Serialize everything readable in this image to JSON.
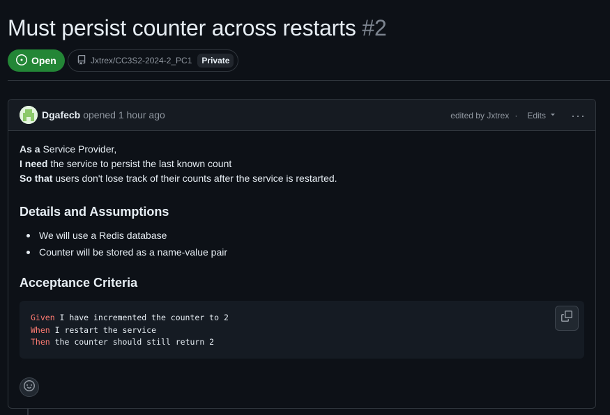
{
  "issue": {
    "title": "Must persist counter across restarts",
    "number": "#2",
    "state": "Open",
    "repo": "Jxtrex/CC3S2-2024-2_PC1",
    "visibility": "Private"
  },
  "comment": {
    "author": "Dgafecb",
    "opened_text": "opened 1 hour ago",
    "edited_text": "edited by Jxtrex",
    "separator": "·",
    "edits_label": "Edits",
    "more_label": "···",
    "story": [
      {
        "bold": "As a",
        "text": " Service Provider,"
      },
      {
        "bold": "I need",
        "text": " the service to persist the last known count"
      },
      {
        "bold": "So that",
        "text": " users don't lose track of their counts after the service is restarted."
      }
    ],
    "details_heading": "Details and Assumptions",
    "details_items": [
      "We will use a Redis database",
      "Counter will be stored as a name-value pair"
    ],
    "criteria_heading": "Acceptance Criteria",
    "code_lines": [
      {
        "kw": "Given",
        "text": " I have incremented the counter to 2"
      },
      {
        "kw": "When",
        "text": " I restart the service"
      },
      {
        "kw": "Then",
        "text": " the counter should still return 2"
      }
    ]
  },
  "colors": {
    "background": "#0d1117",
    "open_green": "#238636",
    "keyword_red": "#ff7b72",
    "muted": "#9198a1",
    "border": "#30363d"
  },
  "icons": {
    "state": "issue-opened-icon",
    "repo": "repo-icon",
    "copy": "copy-icon",
    "reaction": "smiley-icon",
    "edits": "triangle-down-icon",
    "more": "kebab-horizontal-icon"
  }
}
